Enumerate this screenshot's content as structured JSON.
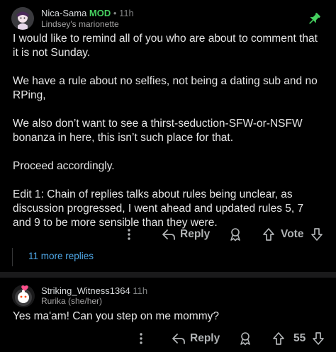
{
  "comments": [
    {
      "username": "Nica-Sama",
      "mod_badge": "MOD",
      "time": "• 11h",
      "flair": "Lindsey's marionette",
      "body": "I would like to remind all of you who are about to comment that it is not Sunday.\n\nWe have a rule about no selfies, not being a dating sub and no RPing,\n\nWe also don’t want to see a thirst-seduction-SFW-or-NSFW bonanza in here, this isn’t such place for that.\n\nProceed accordingly.\n\nEdit 1: Chain of replies talks about rules being unclear, as discussion progressed, I went ahead and updated rules 5, 7 and 9 to be more sensible than they were.",
      "actions": {
        "reply_label": "Reply",
        "vote_label": "Vote"
      },
      "more_replies": "11 more replies"
    },
    {
      "username": "Striking_Witness1364",
      "time": "11h",
      "flair": "Rurika (she/her)",
      "body": "Yes ma'am! Can you step on me mommy?",
      "actions": {
        "reply_label": "Reply",
        "score": "55"
      }
    }
  ],
  "colors": {
    "mod": "#46d160",
    "pin": "#46d160",
    "link": "#4fa8e8",
    "background": "#000000"
  },
  "icons": {
    "pin": "pin-icon",
    "more": "more-options-icon",
    "reply": "reply-arrow-icon",
    "award": "award-icon",
    "upvote": "upvote-icon",
    "downvote": "downvote-icon"
  }
}
